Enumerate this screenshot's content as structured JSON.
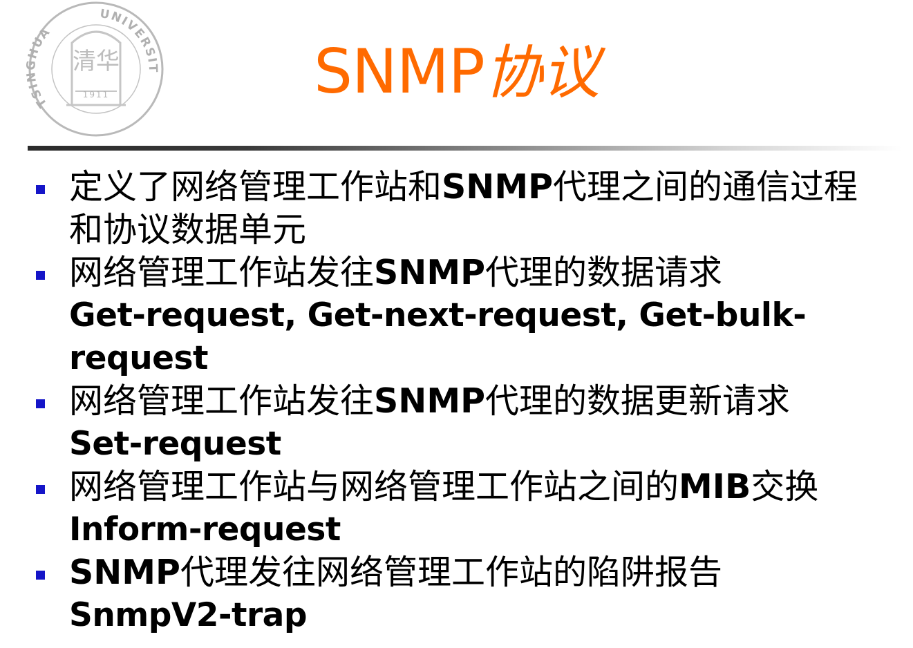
{
  "logo": {
    "top_arc_text": "UNIVERSITY",
    "left_arc_text": "TSINGHUA",
    "year": "1911",
    "seal_characters": "清华"
  },
  "title": {
    "latin": "SNMP",
    "chinese": "协议"
  },
  "colors": {
    "title": "#ff6a00",
    "bullet": "#1515c8",
    "rule_dark": "#2b2b2b"
  },
  "bullets": [
    {
      "l1_a": "定义了网络管理工作站和",
      "l1_b": "SNMP",
      "l1_c": "代理之间的通信过程",
      "l2": "和协议数据单元"
    },
    {
      "l1_a": "网络管理工作站发往",
      "l1_b": "SNMP",
      "l1_c": "代理的数据请求",
      "l2": "Get-request, Get-next-request, Get-bulk-",
      "l3": "request"
    },
    {
      "l1_a": "网络管理工作站发往",
      "l1_b": "SNMP",
      "l1_c": "代理的数据更新请求",
      "l2": "Set-request"
    },
    {
      "l1_a": "网络管理工作站与网络管理工作站之间的",
      "l1_b": "MIB",
      "l1_c": "交换",
      "l2": "Inform-request"
    },
    {
      "l1_a": "",
      "l1_b": "SNMP",
      "l1_c": "代理发往网络管理工作站的陷阱报告",
      "l2": "SnmpV2-trap"
    }
  ]
}
